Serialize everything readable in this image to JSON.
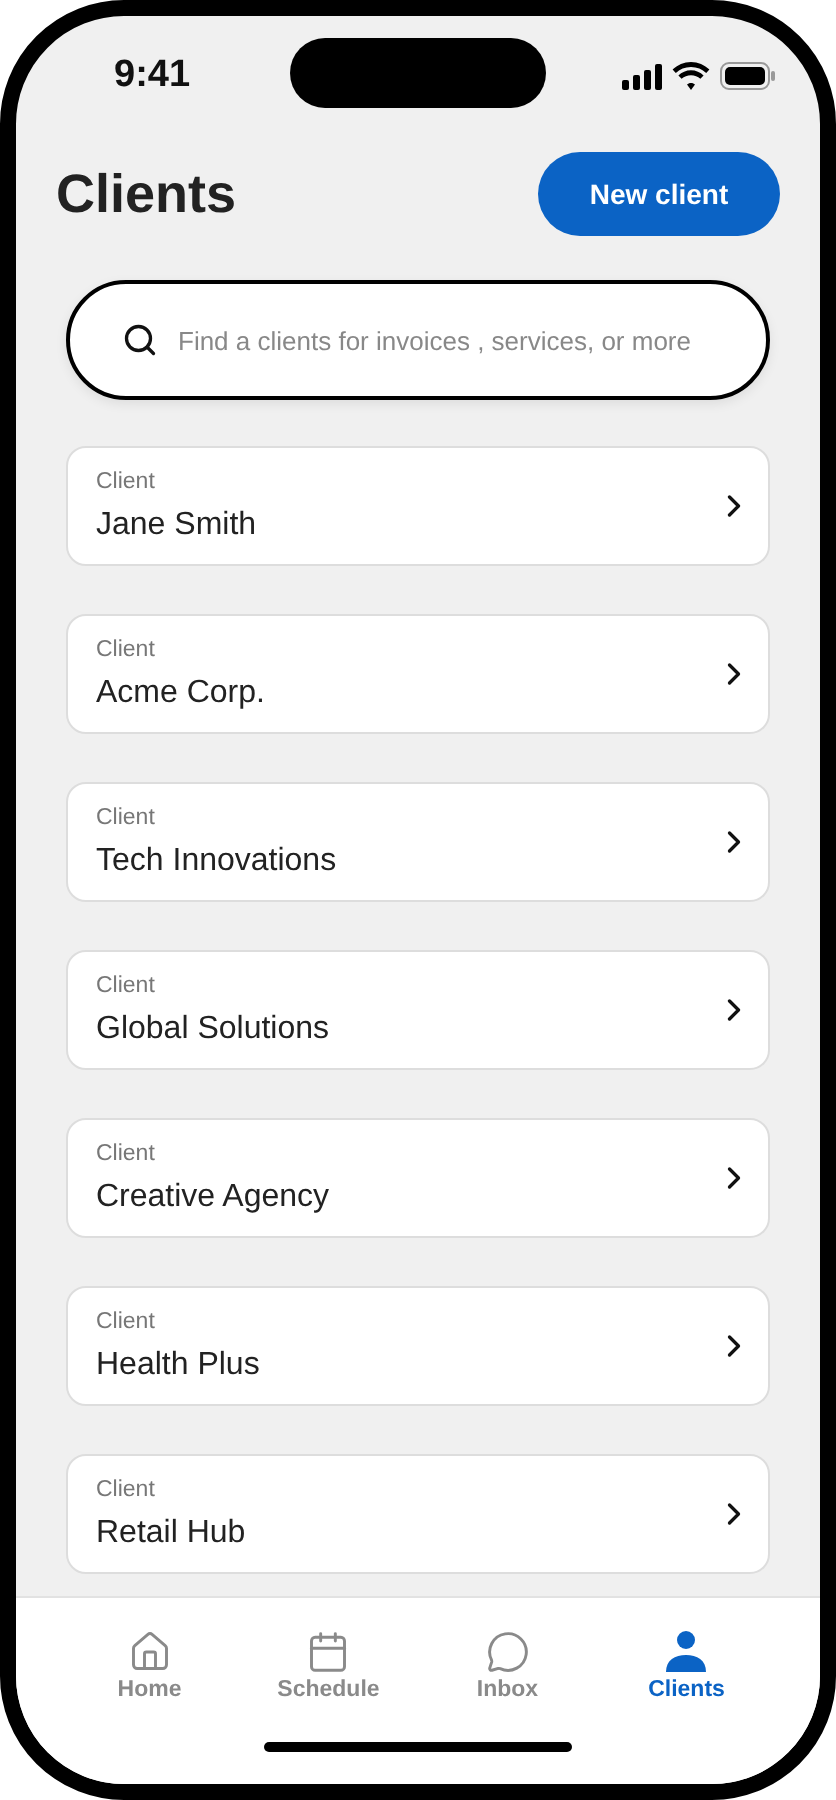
{
  "status_bar": {
    "time": "9:41"
  },
  "header": {
    "title": "Clients",
    "new_button": "New client"
  },
  "search": {
    "placeholder": "Find a clients for invoices , services, or more"
  },
  "clients": [
    {
      "label": "Client",
      "name": "Jane Smith"
    },
    {
      "label": "Client",
      "name": "Acme Corp."
    },
    {
      "label": "Client",
      "name": "Tech Innovations"
    },
    {
      "label": "Client",
      "name": "Global Solutions"
    },
    {
      "label": "Client",
      "name": "Creative Agency"
    },
    {
      "label": "Client",
      "name": "Health Plus"
    },
    {
      "label": "Client",
      "name": "Retail Hub"
    }
  ],
  "tab_bar": [
    {
      "kind": "home",
      "label": "Home",
      "selected": false
    },
    {
      "kind": "schedule",
      "label": "Schedule",
      "selected": false
    },
    {
      "kind": "inbox",
      "label": "Inbox",
      "selected": false
    },
    {
      "kind": "clients",
      "label": "Clients",
      "selected": true
    }
  ]
}
